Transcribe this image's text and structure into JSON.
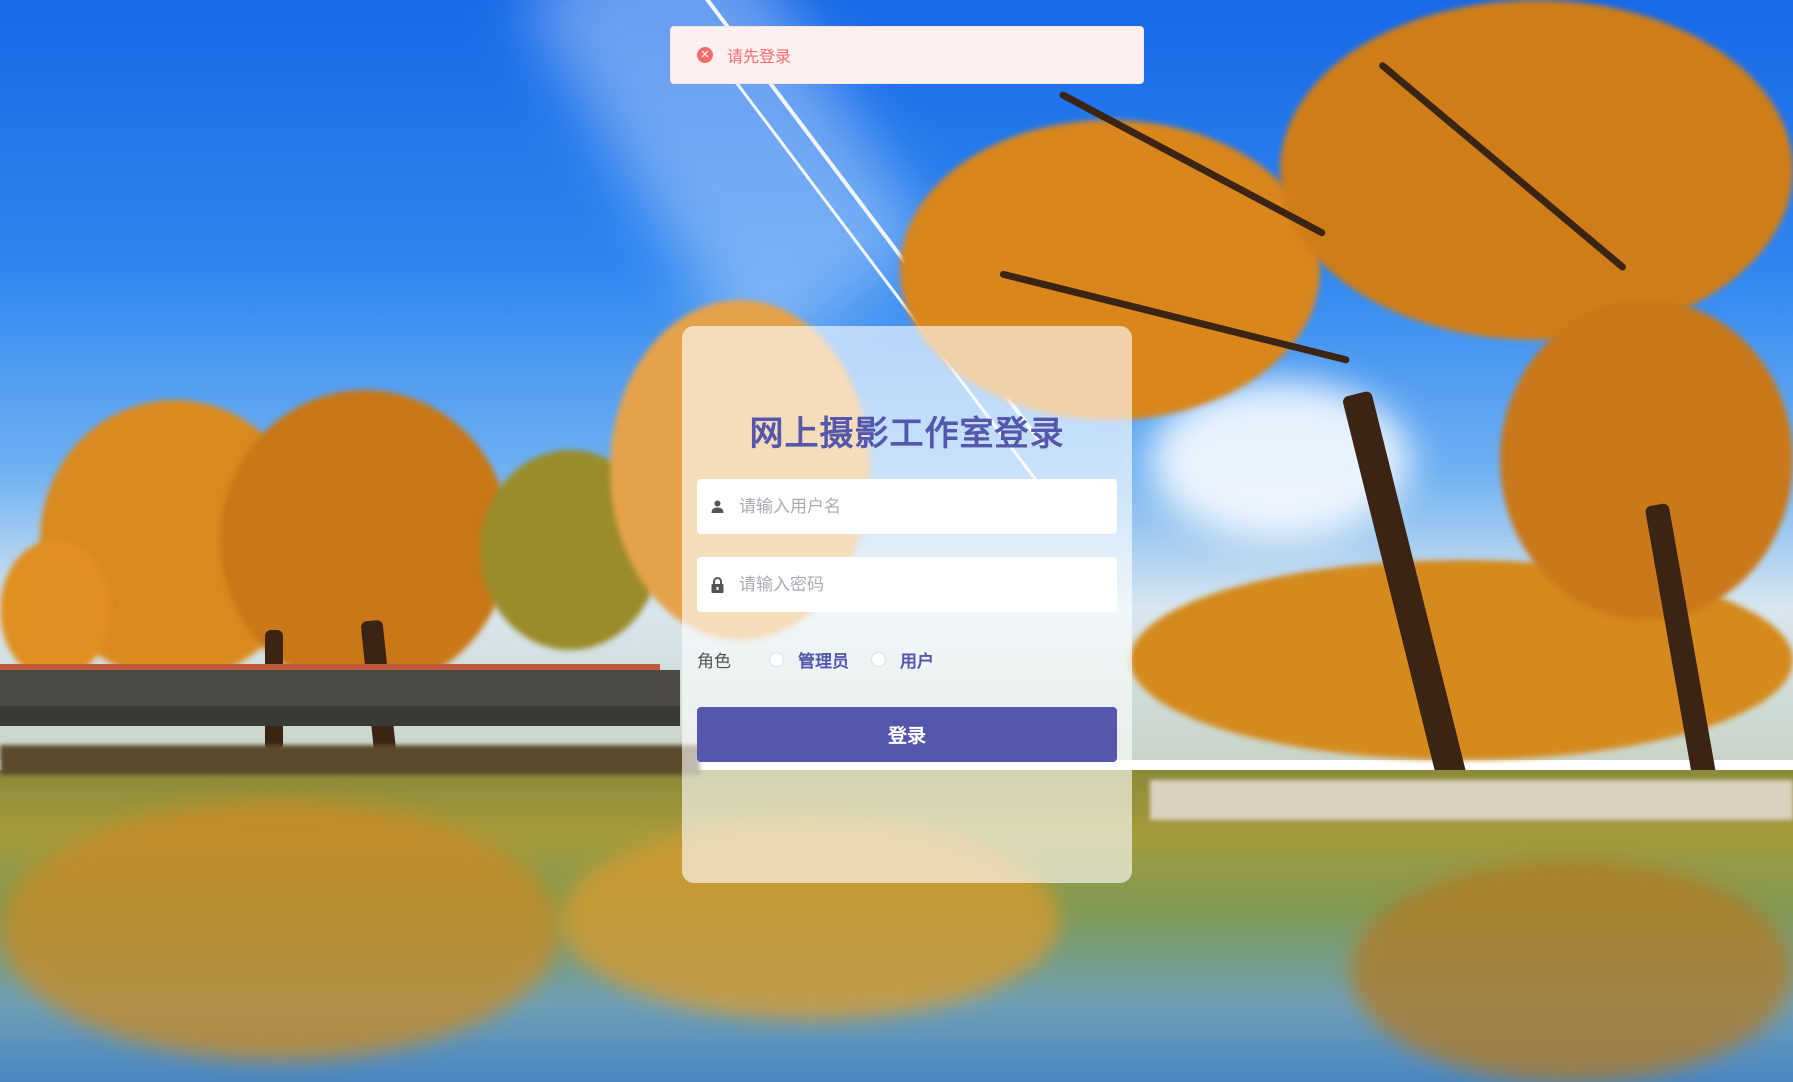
{
  "message": {
    "type": "error",
    "text": "请先登录",
    "icon": "close-circle-icon"
  },
  "login": {
    "title": "网上摄影工作室登录",
    "username": {
      "placeholder": "请输入用户名",
      "value": "",
      "icon": "user-icon"
    },
    "password": {
      "placeholder": "请输入密码",
      "value": "",
      "icon": "lock-icon"
    },
    "role_label": "角色",
    "roles": [
      "管理员",
      "用户"
    ],
    "selected_role": null,
    "submit_label": "登录"
  },
  "colors": {
    "primary": "#5457ac",
    "error_text": "#f56c6c",
    "error_bg": "#fef0f0"
  }
}
